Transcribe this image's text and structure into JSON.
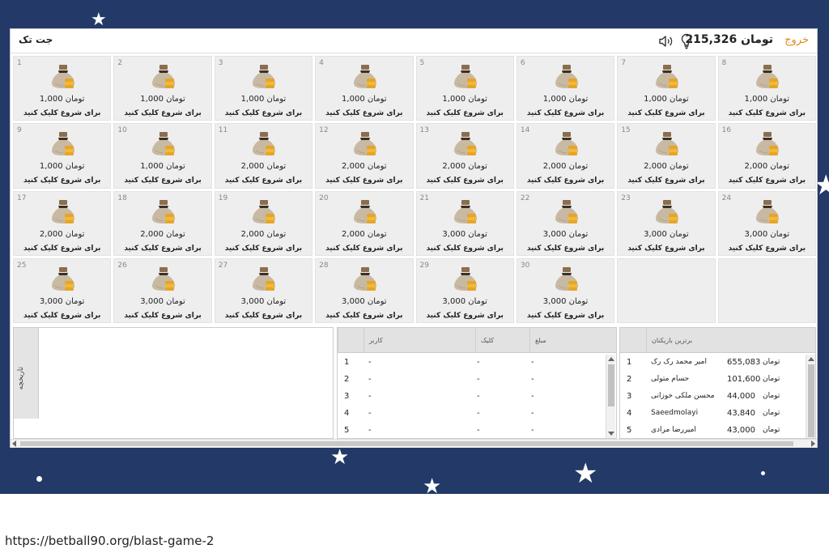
{
  "header": {
    "title": "جت تک",
    "exit_label": "خروج",
    "balance_amount": "215,326",
    "balance_unit": "تومان"
  },
  "icons": {
    "speaker": "speaker-icon",
    "hint": "lightbulb-icon",
    "cell": "money-bag-icon"
  },
  "cells": [
    {
      "num": "1",
      "amount": "1,000"
    },
    {
      "num": "2",
      "amount": "1,000"
    },
    {
      "num": "3",
      "amount": "1,000"
    },
    {
      "num": "4",
      "amount": "1,000"
    },
    {
      "num": "5",
      "amount": "1,000"
    },
    {
      "num": "6",
      "amount": "1,000"
    },
    {
      "num": "7",
      "amount": "1,000"
    },
    {
      "num": "8",
      "amount": "1,000"
    },
    {
      "num": "9",
      "amount": "1,000"
    },
    {
      "num": "10",
      "amount": "1,000"
    },
    {
      "num": "11",
      "amount": "2,000"
    },
    {
      "num": "12",
      "amount": "2,000"
    },
    {
      "num": "13",
      "amount": "2,000"
    },
    {
      "num": "14",
      "amount": "2,000"
    },
    {
      "num": "15",
      "amount": "2,000"
    },
    {
      "num": "16",
      "amount": "2,000"
    },
    {
      "num": "17",
      "amount": "2,000"
    },
    {
      "num": "18",
      "amount": "2,000"
    },
    {
      "num": "19",
      "amount": "2,000"
    },
    {
      "num": "20",
      "amount": "2,000"
    },
    {
      "num": "21",
      "amount": "3,000"
    },
    {
      "num": "22",
      "amount": "3,000"
    },
    {
      "num": "23",
      "amount": "3,000"
    },
    {
      "num": "24",
      "amount": "3,000"
    },
    {
      "num": "25",
      "amount": "3,000"
    },
    {
      "num": "26",
      "amount": "3,000"
    },
    {
      "num": "27",
      "amount": "3,000"
    },
    {
      "num": "28",
      "amount": "3,000"
    },
    {
      "num": "29",
      "amount": "3,000"
    },
    {
      "num": "30",
      "amount": "3,000"
    }
  ],
  "cell_unit": "تومان",
  "cell_cta": "برای شروع کلیک کنید",
  "history_tab_label": "تاریخچه",
  "recent": {
    "columns": [
      "کاربر",
      "کلیک",
      "مبلغ"
    ],
    "rows": [
      {
        "rank": "1",
        "user": "-",
        "clicks": "-",
        "amount": "-"
      },
      {
        "rank": "2",
        "user": "-",
        "clicks": "-",
        "amount": "-"
      },
      {
        "rank": "3",
        "user": "-",
        "clicks": "-",
        "amount": "-"
      },
      {
        "rank": "4",
        "user": "-",
        "clicks": "-",
        "amount": "-"
      },
      {
        "rank": "5",
        "user": "-",
        "clicks": "-",
        "amount": "-"
      }
    ]
  },
  "top_players": {
    "title": "برترین بازیکنان",
    "rows": [
      {
        "rank": "1",
        "name": "امیر محمد رک رک",
        "amount": "655,083",
        "unit": "تومان"
      },
      {
        "rank": "2",
        "name": "حسام متولی",
        "amount": "101,600",
        "unit": "تومان"
      },
      {
        "rank": "3",
        "name": "محسن ملکی خوزانی",
        "amount": "44,000",
        "unit": "تومان"
      },
      {
        "rank": "4",
        "name": "Saeedmolayi",
        "amount": "43,840",
        "unit": "تومان"
      },
      {
        "rank": "5",
        "name": "امیررضا مرادی",
        "amount": "43,000",
        "unit": "تومان"
      }
    ]
  },
  "colors": {
    "background": "#233a68",
    "accent": "#e08a1e",
    "cell_bg": "#eeeeee"
  },
  "footer_url": "https://betball90.org/blast-game-2"
}
